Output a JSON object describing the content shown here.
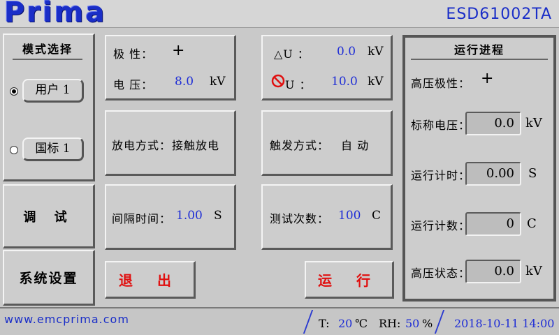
{
  "header": {
    "brand": "Prima",
    "model": "ESD61002TA"
  },
  "mode_select": {
    "title": "模式选择",
    "options": [
      {
        "label": "用户 1",
        "selected": true
      },
      {
        "label": "国标 1",
        "selected": false
      }
    ]
  },
  "nav": {
    "debug": "调 试",
    "settings": "系统设置"
  },
  "params": {
    "polarity_label": "极 性：",
    "polarity_value": "+",
    "voltage_label": "电 压：",
    "voltage_value": "8.0",
    "voltage_unit": "kV",
    "delta_u_label": "△U ：",
    "delta_u_value": "0.0",
    "delta_u_unit": "kV",
    "no_u_label": "U ：",
    "no_u_value": "10.0",
    "no_u_unit": "kV",
    "discharge_label": "放电方式：",
    "discharge_value": "接触放电",
    "trigger_label": "触发方式：",
    "trigger_value": "自 动",
    "interval_label": "间隔时间：",
    "interval_value": "1.00",
    "interval_unit": "S",
    "count_label": "测试次数：",
    "count_value": "100",
    "count_unit": "C"
  },
  "actions": {
    "exit": "退 出",
    "run": "运 行"
  },
  "progress": {
    "title": "运行进程",
    "hv_polarity_label": "高压极性：",
    "hv_polarity_value": "+",
    "nominal_label": "标称电压：",
    "nominal_value": "0.0",
    "nominal_unit": "kV",
    "timer_label": "运行计时：",
    "timer_value": "0.00",
    "timer_unit": "S",
    "counter_label": "运行计数：",
    "counter_value": "0",
    "counter_unit": "C",
    "hv_state_label": "高压状态：",
    "hv_state_value": "0.0",
    "hv_state_unit": "kV"
  },
  "footer": {
    "url": "www.emcprima.com",
    "temp_label": "T:",
    "temp_value": "20",
    "temp_unit": "℃",
    "rh_label": "RH:",
    "rh_value": "50",
    "rh_unit": "%",
    "datetime": "2018-10-11 14:00"
  },
  "colors": {
    "accent_blue": "#1d2cd6",
    "brand_blue": "#1a2ec8",
    "danger_red": "#e01010",
    "panel": "#cdcdcd"
  }
}
